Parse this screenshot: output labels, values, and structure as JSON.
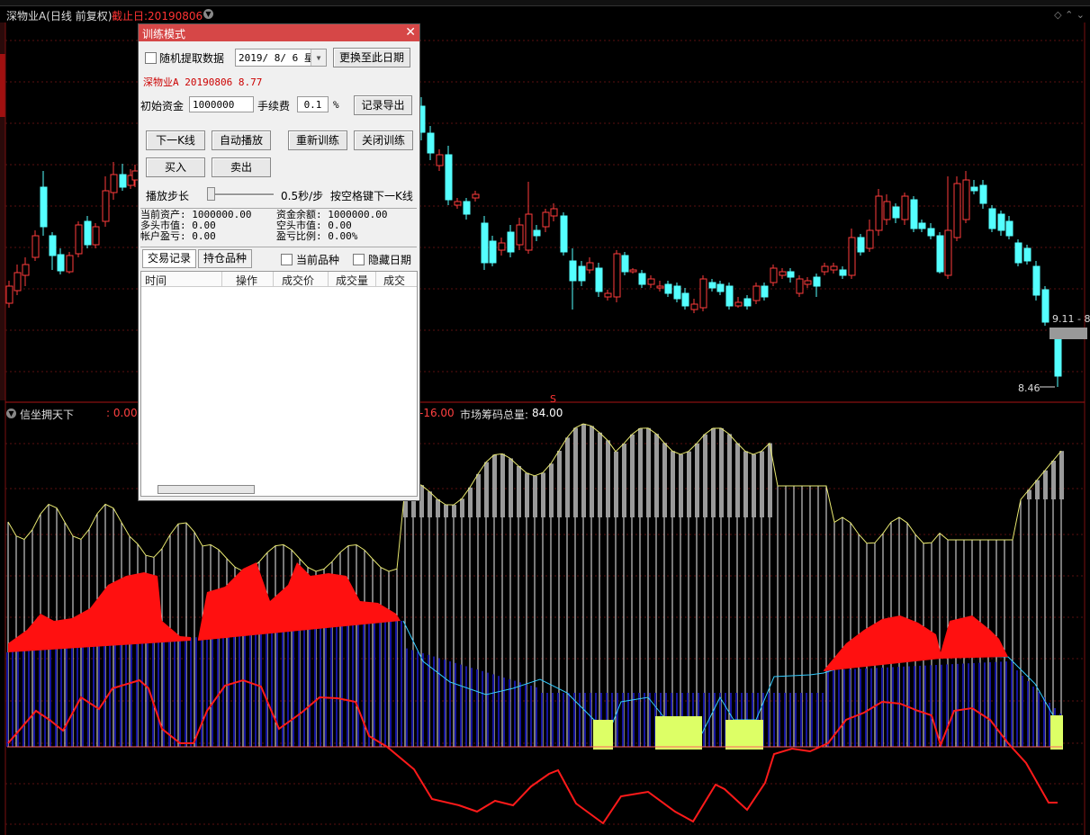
{
  "header": {
    "stock_title": "深物业A(日线 前复权)",
    "deadline": "截止日:20190806"
  },
  "price_chart": {
    "price_label_high": "9.11 - 8",
    "price_label_low": "8.46",
    "marker": "S",
    "up_color": "#ff3c3c",
    "down_color": "#54ffff"
  },
  "indicator": {
    "name": "信坐拥天下",
    "value0": ": 0.00",
    "value1": "-16.00",
    "label": "市场筹码总量:",
    "value": "84.00"
  },
  "dialog": {
    "title": "训练模式",
    "close_icon": "close-icon",
    "random_label": "随机提取数据",
    "date_value": "2019/ 8/ 6 星",
    "change_date_btn": "更换至此日期",
    "stock_info": "深物业A 20190806 8.77",
    "capital_label": "初始资金",
    "capital_value": "1000000",
    "fee_label": "手续费",
    "fee_value": "0.1",
    "fee_unit": "%",
    "export_btn": "记录导出",
    "next_btn": "下一K线",
    "auto_btn": "自动播放",
    "restart_btn": "重新训练",
    "close_btn": "关闭训练",
    "buy_btn": "买入",
    "sell_btn": "卖出",
    "step_label": "播放步长",
    "step_value": "0.5秒/步",
    "hint": "按空格键下一K线",
    "stats": {
      "total_assets": "当前资产: 1000000.00",
      "cash": "资金余额: 1000000.00",
      "long_value": "多头市值: 0.00",
      "short_value": "空头市值: 0.00",
      "pnl": "帐户盈亏: 0.00",
      "pnl_ratio": "盈亏比例: 0.00%"
    },
    "tabs": [
      "交易记录",
      "持仓品种"
    ],
    "current_label": "当前品种",
    "hide_date_label": "隐藏日期",
    "columns": [
      "时间",
      "操作",
      "成交价",
      "成交量",
      "成交"
    ]
  },
  "chart_data": {
    "type": "candlestick",
    "title": "深物业A(日线 前复权)",
    "note": "Daily candles, price axis range approx 8.46 to 10.5",
    "candles": [
      {
        "o": 8.77,
        "c": 8.87,
        "h": 8.92,
        "l": 8.7,
        "up": true
      },
      {
        "o": 8.86,
        "c": 8.97,
        "h": 9.02,
        "l": 8.83,
        "up": true
      },
      {
        "o": 8.95,
        "c": 9.05,
        "h": 9.1,
        "l": 8.9,
        "up": true
      },
      {
        "o": 9.1,
        "c": 9.2,
        "h": 9.25,
        "l": 9.05,
        "up": true
      },
      {
        "o": 9.35,
        "c": 9.65,
        "h": 9.7,
        "l": 9.2,
        "up": false
      },
      {
        "o": 9.3,
        "c": 9.2,
        "h": 9.35,
        "l": 9.1,
        "up": false
      },
      {
        "o": 9.1,
        "c": 9.05,
        "h": 9.15,
        "l": 9.0,
        "up": false
      },
      {
        "o": 9.05,
        "c": 9.15,
        "h": 9.2,
        "l": 9.0,
        "up": true
      },
      {
        "o": 9.2,
        "c": 9.32,
        "h": 9.4,
        "l": 9.15,
        "up": true
      },
      {
        "o": 9.35,
        "c": 9.25,
        "h": 9.45,
        "l": 9.2,
        "up": false
      },
      {
        "o": 9.25,
        "c": 9.35,
        "h": 9.42,
        "l": 9.2,
        "up": true
      },
      {
        "o": 9.4,
        "c": 9.6,
        "h": 9.65,
        "l": 9.35,
        "up": true
      },
      {
        "o": 9.6,
        "c": 9.75,
        "h": 9.82,
        "l": 9.55,
        "up": true
      },
      {
        "o": 9.75,
        "c": 9.7,
        "h": 9.8,
        "l": 9.65,
        "up": false
      },
      {
        "o": 9.72,
        "c": 9.78,
        "h": 9.82,
        "l": 9.68,
        "up": true
      },
      {
        "o": 9.78,
        "c": 9.85,
        "h": 9.9,
        "l": 9.74,
        "up": true
      }
    ]
  }
}
